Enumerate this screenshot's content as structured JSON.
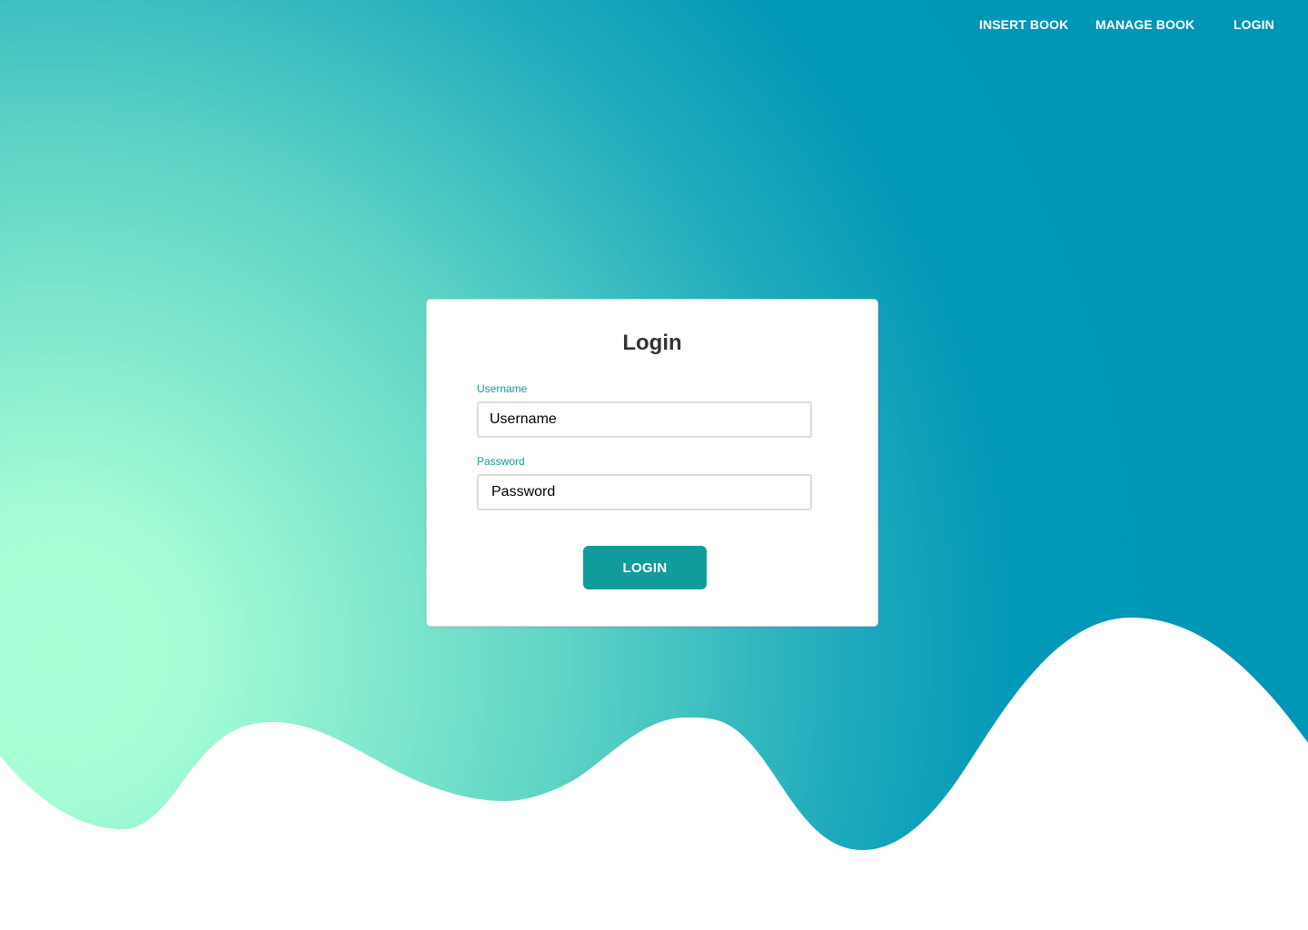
{
  "nav": {
    "items": [
      {
        "label": "INSERT BOOK"
      },
      {
        "label": "MANAGE BOOK"
      },
      {
        "label": "LOGIN"
      }
    ]
  },
  "login_card": {
    "title": "Login",
    "username": {
      "label": "Username",
      "placeholder": "Username"
    },
    "password": {
      "label": "Password",
      "placeholder": "Password"
    },
    "submit_label": "LOGIN"
  },
  "colors": {
    "gradient_light": "#a8ffd6",
    "gradient_mid": "#4fc9c4",
    "gradient_dark": "#0096b6",
    "accent": "#129b9b",
    "label_color": "#129a9a"
  }
}
